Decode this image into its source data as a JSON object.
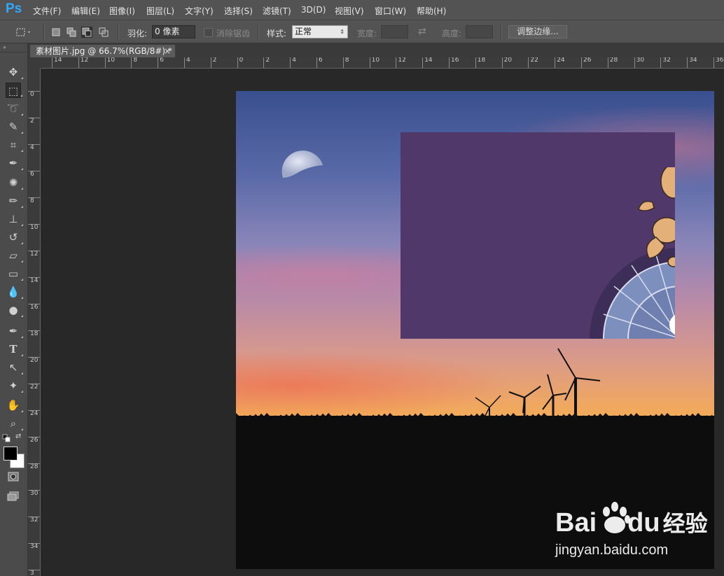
{
  "app": {
    "logo": "Ps"
  },
  "menubar": {
    "items": [
      "文件(F)",
      "编辑(E)",
      "图像(I)",
      "图层(L)",
      "文字(Y)",
      "选择(S)",
      "滤镜(T)",
      "3D(D)",
      "视图(V)",
      "窗口(W)",
      "帮助(H)"
    ]
  },
  "options_bar": {
    "feather_label": "羽化:",
    "feather_value": "0 像素",
    "antialias_label": "消除锯齿",
    "style_label": "样式:",
    "style_value": "正常",
    "width_label": "宽度:",
    "height_label": "高度:",
    "refine_edge_button": "调整边缘..."
  },
  "document_tab": {
    "title": "素材图片.jpg @ 66.7%(RGB/8#) *",
    "close": "×"
  },
  "rulers": {
    "horizontal": [
      "14",
      "12",
      "10",
      "8",
      "6",
      "4",
      "2",
      "0",
      "2",
      "4",
      "6",
      "8",
      "10",
      "12",
      "14",
      "16",
      "18",
      "20",
      "22",
      "24",
      "26",
      "28",
      "30",
      "32",
      "34",
      "36"
    ],
    "vertical": [
      "0",
      "2",
      "4",
      "6",
      "8",
      "10",
      "12",
      "14",
      "16",
      "18",
      "20",
      "22",
      "24",
      "26",
      "28",
      "30",
      "32",
      "34",
      "3"
    ]
  },
  "tools": [
    "move-tool",
    "marquee-tool",
    "lasso-tool",
    "quick-selection-tool",
    "crop-tool",
    "eyedropper-tool",
    "healing-brush-tool",
    "brush-tool",
    "clone-stamp-tool",
    "history-brush-tool",
    "eraser-tool",
    "gradient-tool",
    "blur-tool",
    "dodge-tool",
    "pen-tool",
    "type-tool",
    "path-selection-tool",
    "shape-tool",
    "hand-tool",
    "zoom-tool"
  ],
  "tool_glyphs": {
    "type-tool": "T"
  },
  "watermark": {
    "logo_text": "Bai",
    "logo_suffix": "du",
    "logo_cn": "经验",
    "url": "jingyan.baidu.com"
  },
  "colors": {
    "overlay": "#51386a",
    "accent": "#31a8ff"
  }
}
